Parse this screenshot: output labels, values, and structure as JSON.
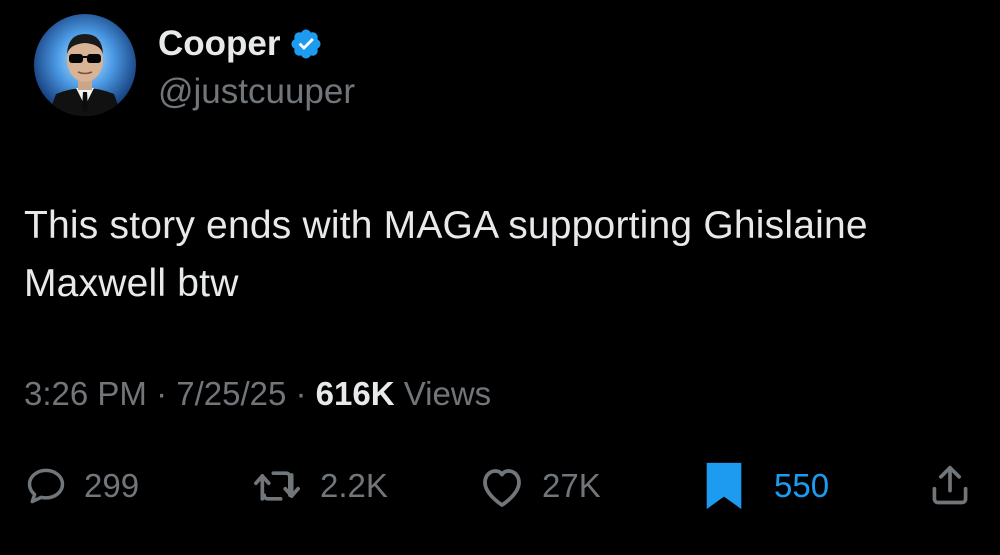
{
  "tweet": {
    "author": {
      "display_name": "Cooper",
      "handle": "@justcuuper",
      "verified": true,
      "avatar_icon": "avatar-man-in-sunglasses"
    },
    "text": "This story ends with MAGA supporting Ghislaine Maxwell btw",
    "timestamp": {
      "time": "3:26 PM",
      "separator1": " · ",
      "date": "7/25/25",
      "separator2": " · ",
      "views_count": "616K",
      "views_label": " Views"
    },
    "actions": {
      "replies": {
        "icon": "reply-icon",
        "count": "299"
      },
      "retweets": {
        "icon": "retweet-icon",
        "count": "2.2K"
      },
      "likes": {
        "icon": "like-icon",
        "count": "27K"
      },
      "bookmarks": {
        "icon": "bookmark-filled-icon",
        "count": "550",
        "active": true
      },
      "share": {
        "icon": "share-icon"
      }
    }
  },
  "colors": {
    "background": "#000000",
    "primary_text": "#e7e9ea",
    "secondary_text": "#71767b",
    "accent": "#1d9bf0"
  }
}
